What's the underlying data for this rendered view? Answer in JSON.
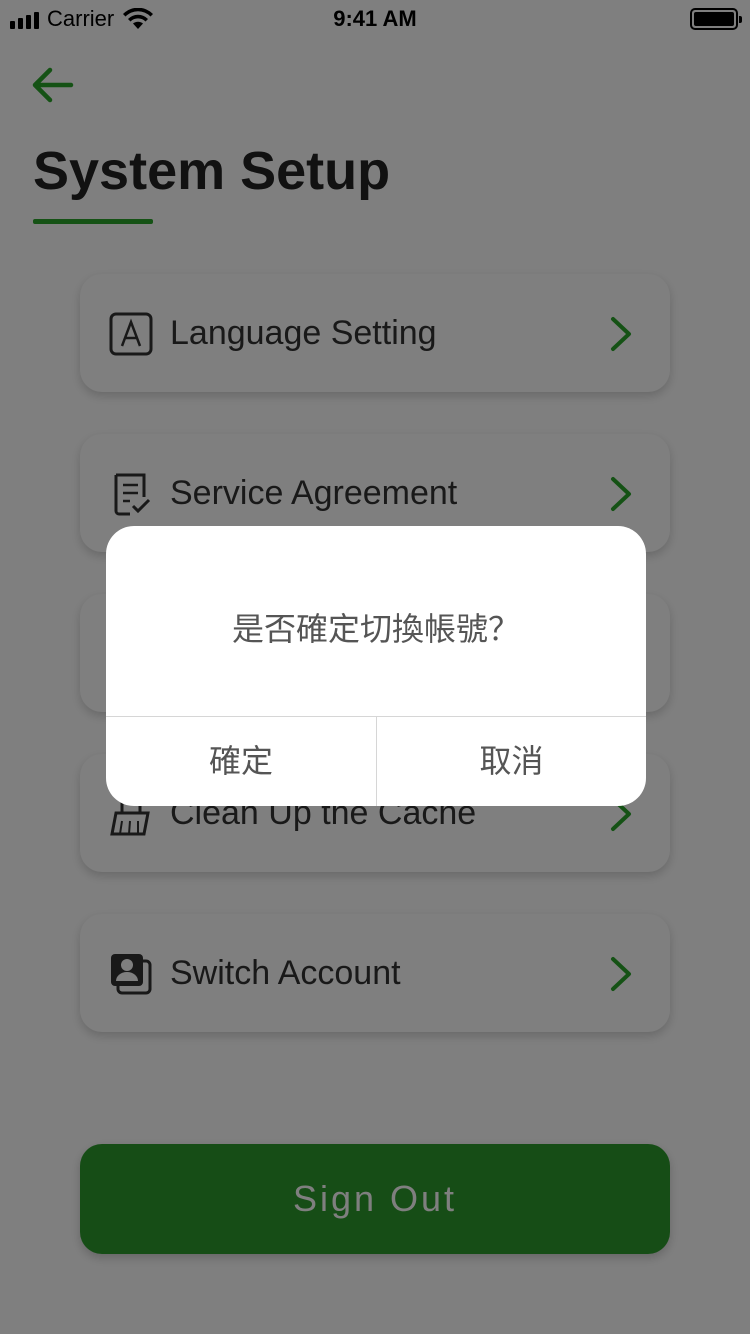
{
  "status_bar": {
    "carrier": "Carrier",
    "time": "9:41 AM"
  },
  "header": {
    "title": "System Setup"
  },
  "menu": {
    "items": [
      {
        "label": "Language Setting",
        "icon": "language-icon"
      },
      {
        "label": "Service Agreement",
        "icon": "agreement-icon"
      },
      {
        "label": "",
        "icon": ""
      },
      {
        "label": "Clean Up the Cache",
        "icon": "broom-icon"
      },
      {
        "label": "Switch Account",
        "icon": "account-switch-icon"
      }
    ]
  },
  "sign_out_label": "Sign Out",
  "dialog": {
    "message": "是否確定切換帳號？",
    "confirm_label": "確定",
    "cancel_label": "取消"
  },
  "colors": {
    "accent": "#2aa52a",
    "button": "#2d9b2d"
  }
}
